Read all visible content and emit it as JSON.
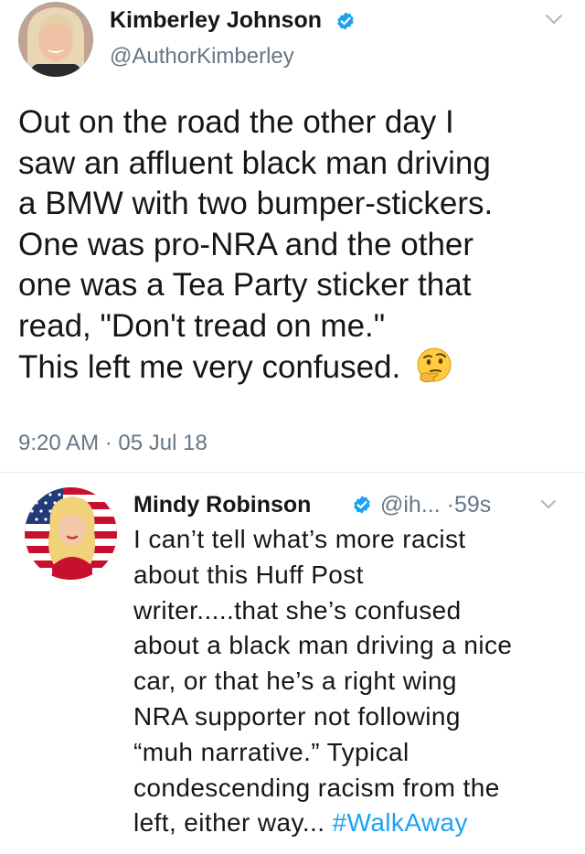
{
  "tweet": {
    "author_name": "Kimberley Johnson",
    "author_handle": "@AuthorKimberley",
    "text_lines": [
      "Out on the road the other day I",
      "saw an affluent black man driving",
      "a BMW with two bumper-stickers.",
      "One was pro-NRA and the other",
      "one was a Tea Party sticker that",
      "read, \"Don't tread on me.\"",
      "This left me very confused."
    ],
    "emoji": "thinking-face",
    "time": "9:20 AM",
    "separator": "·",
    "date": "05 Jul 18"
  },
  "reply": {
    "author_name": "Mindy Robinson",
    "author_handle": "@ih...",
    "separator": "·",
    "age": "59s",
    "text_lines": [
      "I can’t tell what’s more racist",
      "about this Huff Post",
      "writer.....that she’s confused",
      "about a black man driving a nice",
      "car, or that he’s a right wing",
      "NRA supporter not following",
      "“muh narrative.” Typical",
      "condescending racism from the",
      "left, either way... "
    ],
    "hashtag": "#WalkAway"
  },
  "colors": {
    "text": "#14171a",
    "secondary": "#657786",
    "link": "#1da1f2",
    "verified": "#1da1f2",
    "divider": "#e1e8ed"
  }
}
